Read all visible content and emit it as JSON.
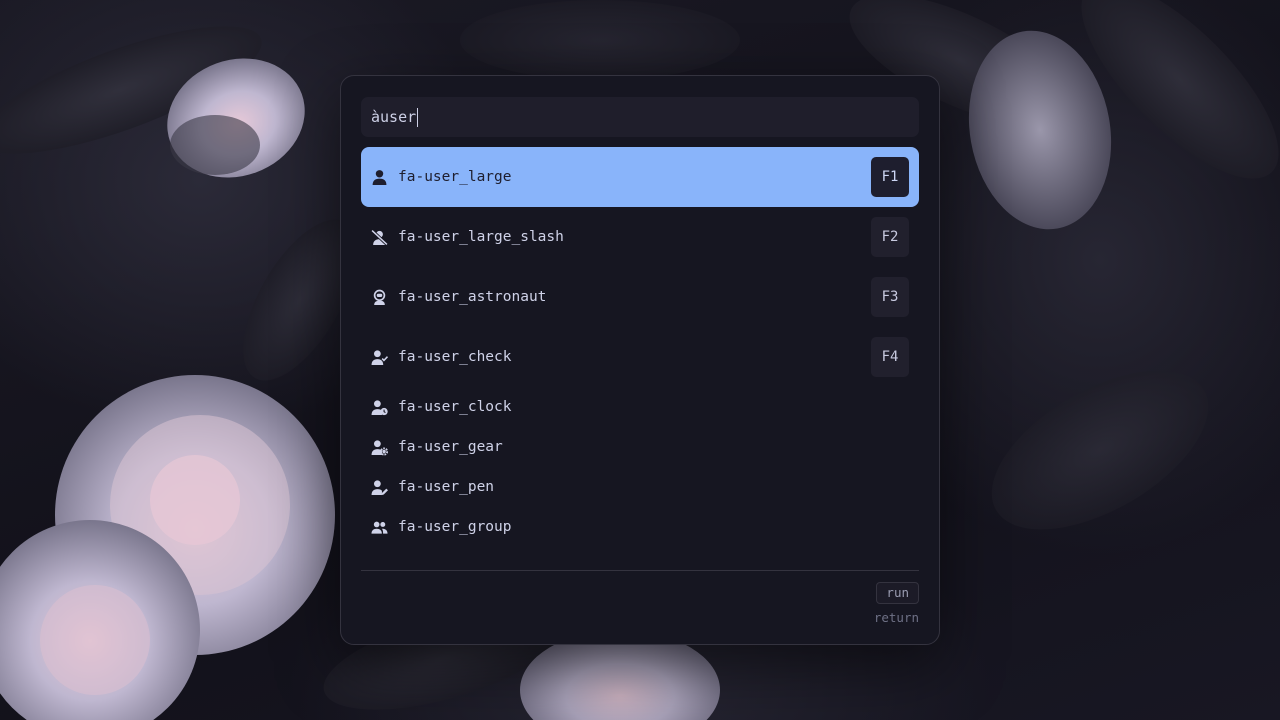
{
  "search": {
    "query": "àuser"
  },
  "results": [
    {
      "icon": "user-icon",
      "label": "fa-user_large",
      "key": "F1",
      "selected": true
    },
    {
      "icon": "user-slash-icon",
      "label": "fa-user_large_slash",
      "key": "F2",
      "selected": false
    },
    {
      "icon": "user-astronaut-icon",
      "label": "fa-user_astronaut",
      "key": "F3",
      "selected": false
    },
    {
      "icon": "user-check-icon",
      "label": "fa-user_check",
      "key": "F4",
      "selected": false
    },
    {
      "icon": "user-clock-icon",
      "label": "fa-user_clock",
      "key": "",
      "selected": false
    },
    {
      "icon": "user-gear-icon",
      "label": "fa-user_gear",
      "key": "",
      "selected": false
    },
    {
      "icon": "user-pen-icon",
      "label": "fa-user_pen",
      "key": "",
      "selected": false
    },
    {
      "icon": "user-group-icon",
      "label": "fa-user_group",
      "key": "",
      "selected": false
    }
  ],
  "footer": {
    "action_label": "run",
    "action_hint": "return"
  },
  "colors": {
    "accent": "#89b4fa",
    "panel": "#161621",
    "input": "#1f1e2b",
    "text": "#cfd2e8"
  }
}
